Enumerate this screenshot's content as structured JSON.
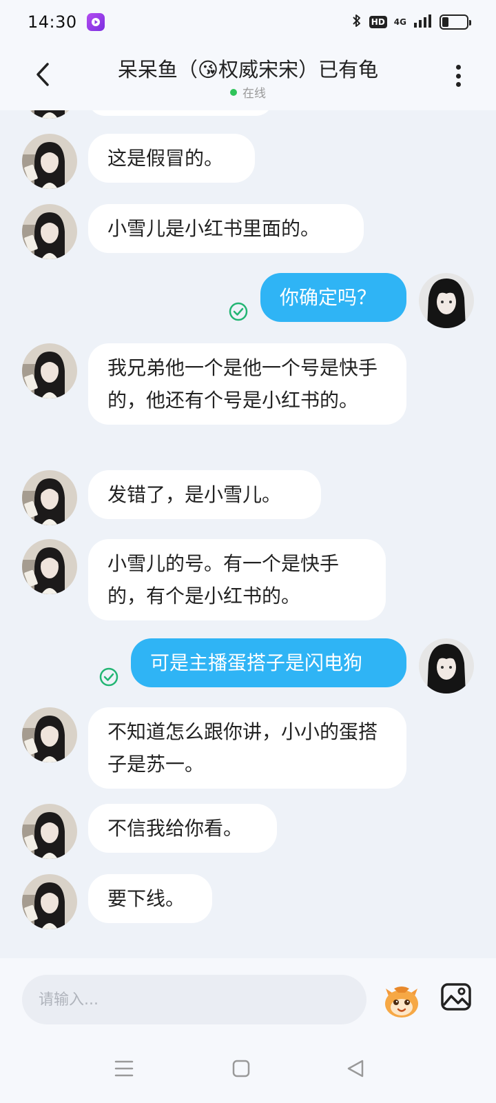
{
  "status_bar": {
    "time": "14:30",
    "network": "4G",
    "hd": "HD",
    "battery_level": 0.25,
    "icons": [
      "app-icon",
      "bluetooth-icon",
      "hd-icon",
      "signal-icon",
      "battery-icon"
    ]
  },
  "header": {
    "title": "呆呆鱼（😘权威宋宋）已有龟",
    "status": "在线",
    "status_color": "#2fc45a"
  },
  "messages": [
    {
      "side": "in",
      "text": "这是假冒的。"
    },
    {
      "side": "in",
      "text": "小雪儿是小红书里面的。"
    },
    {
      "side": "out",
      "text": "你确定吗？",
      "read": true
    },
    {
      "side": "in",
      "text": "我兄弟他一个是他一个号是快手的，他还有个号是小红书的。"
    },
    {
      "side": "in",
      "text": "发错了，是小雪儿。"
    },
    {
      "side": "in",
      "text": "小雪儿的号。有一个是快手的，有个是小红书的。"
    },
    {
      "side": "out",
      "text": "可是主播蛋搭子是闪电狗",
      "read": true
    },
    {
      "side": "in",
      "text": "不知道怎么跟你讲，小小的蛋搭子是苏一。"
    },
    {
      "side": "in",
      "text": "不信我给你看。"
    },
    {
      "side": "in",
      "text": "要下线。"
    }
  ],
  "input": {
    "placeholder": "请输入..."
  },
  "colors": {
    "outgoing_bubble": "#2fb4f5",
    "incoming_bubble": "#ffffff",
    "read_check": "#22b573",
    "background": "#eef2f8"
  }
}
